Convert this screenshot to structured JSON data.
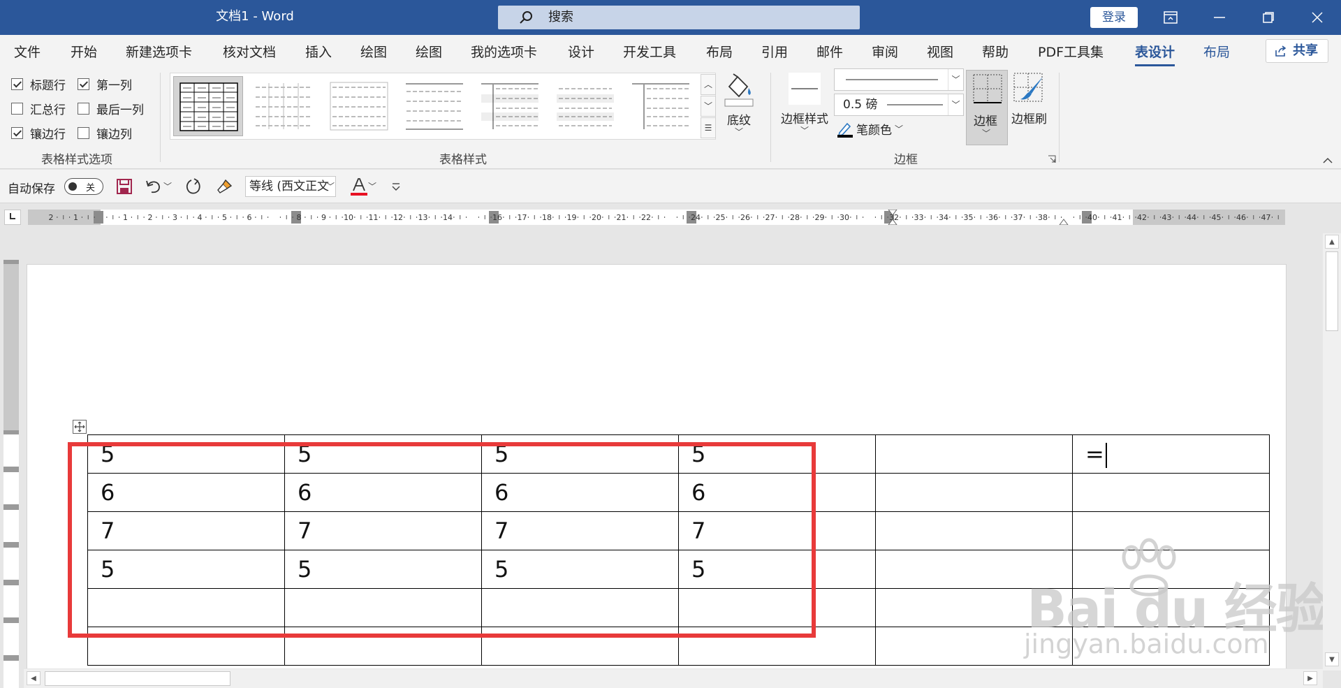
{
  "titlebar": {
    "title": "文档1  -  Word",
    "search_placeholder": "搜索",
    "login": "登录"
  },
  "tabs": [
    {
      "label": "文件"
    },
    {
      "label": "开始"
    },
    {
      "label": "新建选项卡"
    },
    {
      "label": "核对文档"
    },
    {
      "label": "插入"
    },
    {
      "label": "绘图"
    },
    {
      "label": "绘图"
    },
    {
      "label": "我的选项卡"
    },
    {
      "label": "设计"
    },
    {
      "label": "开发工具"
    },
    {
      "label": "布局"
    },
    {
      "label": "引用"
    },
    {
      "label": "邮件"
    },
    {
      "label": "审阅"
    },
    {
      "label": "视图"
    },
    {
      "label": "帮助"
    },
    {
      "label": "PDF工具集"
    },
    {
      "label": "表设计"
    },
    {
      "label": "布局"
    }
  ],
  "share": "共享",
  "ribbon": {
    "style_options": {
      "header_row": "标题行",
      "first_column": "第一列",
      "total_row": "汇总行",
      "last_column": "最后一列",
      "banded_rows": "镶边行",
      "banded_columns": "镶边列",
      "group_label": "表格样式选项"
    },
    "table_styles_label": "表格样式",
    "shading": "底纹",
    "border_styles": "边框样式",
    "pen_weight": "0.5 磅",
    "pen_color": "笔颜色",
    "borders": "边框",
    "border_painter": "边框刷",
    "borders_group_label": "边框"
  },
  "qat": {
    "autosave": "自动保存",
    "autosave_state": "关",
    "font": "等线 (西文正文"
  },
  "ruler": {
    "left_ticks": [
      "2",
      "1"
    ],
    "ticks": [
      "1",
      "2",
      "3",
      "4",
      "5",
      "6",
      "8",
      "9",
      "10",
      "11",
      "12",
      "13",
      "14",
      "16",
      "17",
      "18",
      "19",
      "20",
      "21",
      "22",
      "24",
      "25",
      "26",
      "27",
      "28",
      "29",
      "30",
      "32",
      "33",
      "34",
      "35",
      "36",
      "37",
      "38",
      "40",
      "41",
      "42",
      "43",
      "44",
      "45",
      "46",
      "47"
    ]
  },
  "table": {
    "rows": [
      [
        "5",
        "5",
        "5",
        "5",
        "",
        "="
      ],
      [
        "6",
        "6",
        "6",
        "6",
        "",
        ""
      ],
      [
        "7",
        "7",
        "7",
        "7",
        "",
        ""
      ],
      [
        "5",
        "5",
        "5",
        "5",
        "",
        ""
      ],
      [
        "",
        "",
        "",
        "",
        "",
        ""
      ],
      [
        "",
        "",
        "",
        "",
        "",
        ""
      ]
    ]
  },
  "watermark": {
    "brand": "Bai du 经验",
    "url": "jingyan.baidu.com"
  }
}
